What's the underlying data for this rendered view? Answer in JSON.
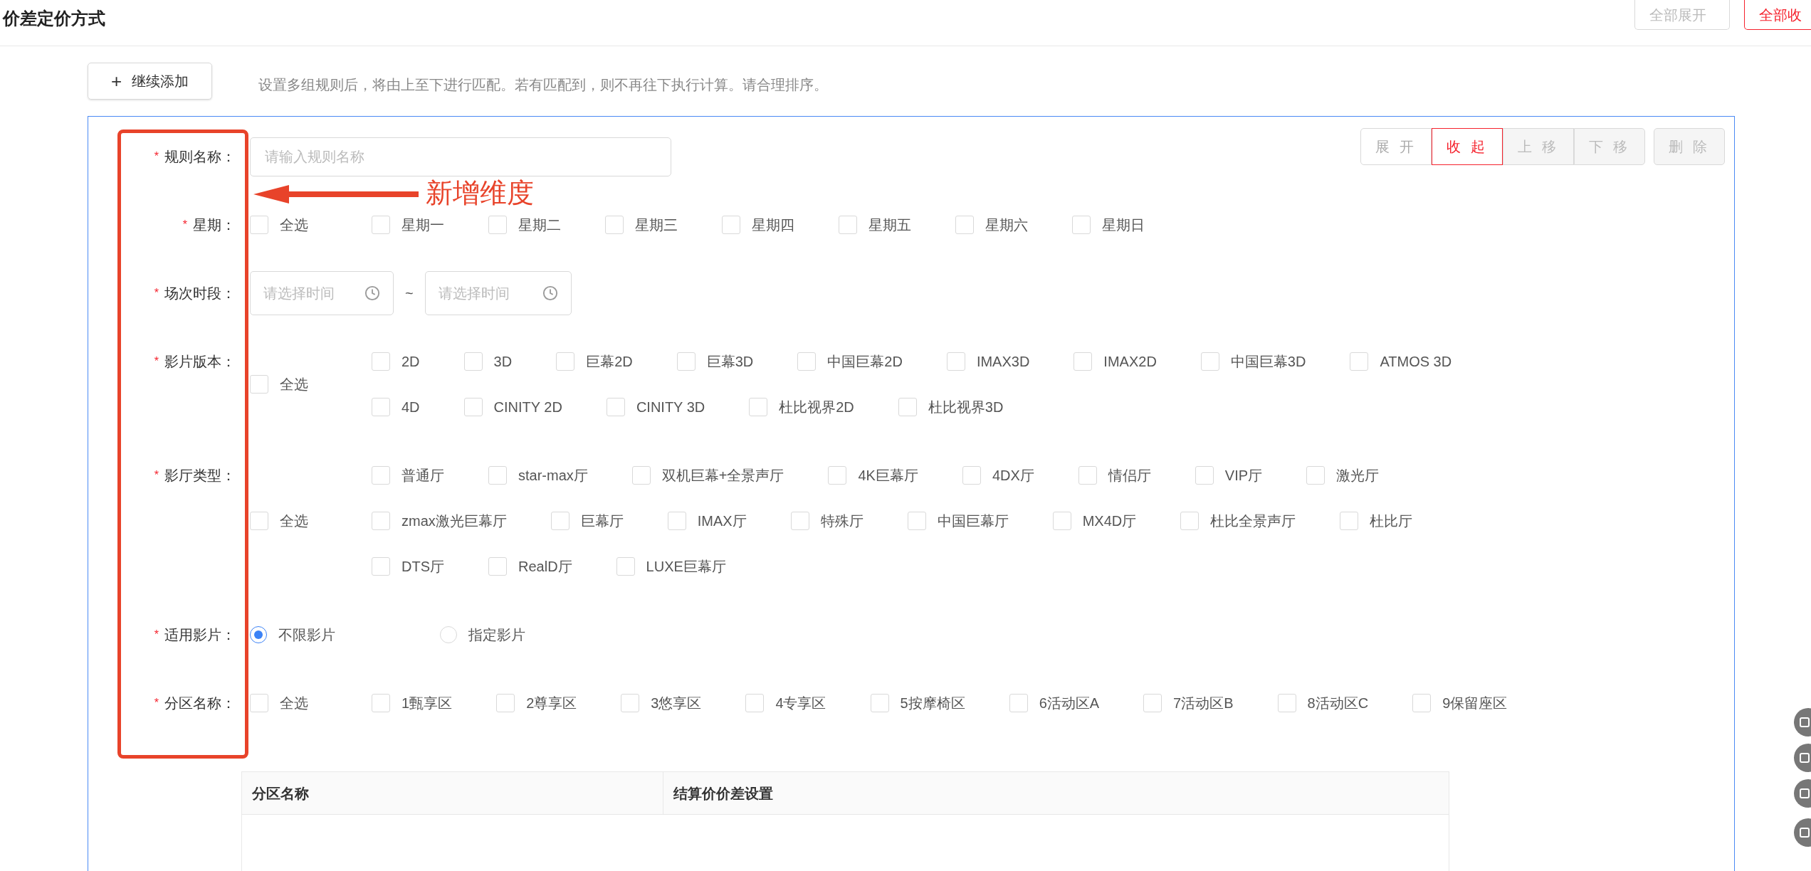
{
  "header": {
    "title": "价差定价方式",
    "buttons": [
      {
        "label": "全部展开",
        "kind": "default"
      },
      {
        "label": "全部收",
        "kind": "danger"
      }
    ]
  },
  "add_button": {
    "label": "继续添加",
    "icon": "+"
  },
  "hint": "设置多组规则后，将由上至下进行匹配。若有匹配到，则不再往下执行计算。请合理排序。",
  "rule": {
    "actions": [
      {
        "label": "展 开",
        "selected": false,
        "disabled": false
      },
      {
        "label": "收 起",
        "selected": true,
        "disabled": false
      },
      {
        "label": "上 移",
        "selected": false,
        "disabled": true
      },
      {
        "label": "下 移",
        "selected": false,
        "disabled": true
      },
      {
        "label": "删 除",
        "selected": false,
        "disabled": true
      }
    ],
    "fields": [
      {
        "kind": "input",
        "label": "规则名称：",
        "required_mark": "*",
        "placeholder": "请输入规则名称"
      },
      {
        "kind": "checkboxes",
        "label": "星期：",
        "required_mark": "*",
        "all": {
          "label": "全选",
          "checked": false
        },
        "option_rows": [
          [
            {
              "label": "星期一",
              "checked": false
            },
            {
              "label": "星期二",
              "checked": false
            },
            {
              "label": "星期三",
              "checked": false
            },
            {
              "label": "星期四",
              "checked": false
            },
            {
              "label": "星期五",
              "checked": false
            },
            {
              "label": "星期六",
              "checked": false
            },
            {
              "label": "星期日",
              "checked": false
            }
          ]
        ]
      },
      {
        "kind": "time_range",
        "label": "场次时段：",
        "required_mark": "*",
        "start_placeholder": "请选择时间",
        "separator": "~",
        "end_placeholder": "请选择时间"
      },
      {
        "kind": "checkboxes",
        "label": "影片版本：",
        "required_mark": "*",
        "all": {
          "label": "全选",
          "checked": false
        },
        "option_rows": [
          [
            {
              "label": "2D",
              "checked": false
            },
            {
              "label": "3D",
              "checked": false
            },
            {
              "label": "巨幕2D",
              "checked": false
            },
            {
              "label": "巨幕3D",
              "checked": false
            },
            {
              "label": "中国巨幕2D",
              "checked": false
            },
            {
              "label": "IMAX3D",
              "checked": false
            },
            {
              "label": "IMAX2D",
              "checked": false
            },
            {
              "label": "中国巨幕3D",
              "checked": false
            },
            {
              "label": "ATMOS 3D",
              "checked": false
            }
          ],
          [
            {
              "label": "4D",
              "checked": false
            },
            {
              "label": "CINITY 2D",
              "checked": false
            },
            {
              "label": "CINITY 3D",
              "checked": false
            },
            {
              "label": "杜比视界2D",
              "checked": false
            },
            {
              "label": "杜比视界3D",
              "checked": false
            }
          ]
        ]
      },
      {
        "kind": "checkboxes",
        "label": "影厅类型：",
        "required_mark": "*",
        "all": {
          "label": "全选",
          "checked": false
        },
        "option_rows": [
          [
            {
              "label": "普通厅",
              "checked": false
            },
            {
              "label": "star-max厅",
              "checked": false
            },
            {
              "label": "双机巨幕+全景声厅",
              "checked": false
            },
            {
              "label": "4K巨幕厅",
              "checked": false
            },
            {
              "label": "4DX厅",
              "checked": false
            },
            {
              "label": "情侣厅",
              "checked": false
            },
            {
              "label": "VIP厅",
              "checked": false
            },
            {
              "label": "激光厅",
              "checked": false
            }
          ],
          [
            {
              "label": "zmax激光巨幕厅",
              "checked": false
            },
            {
              "label": "巨幕厅",
              "checked": false
            },
            {
              "label": "IMAX厅",
              "checked": false
            },
            {
              "label": "特殊厅",
              "checked": false
            },
            {
              "label": "中国巨幕厅",
              "checked": false
            },
            {
              "label": "MX4D厅",
              "checked": false
            },
            {
              "label": "杜比全景声厅",
              "checked": false
            },
            {
              "label": "杜比厅",
              "checked": false
            }
          ],
          [
            {
              "label": "DTS厅",
              "checked": false
            },
            {
              "label": "RealD厅",
              "checked": false
            },
            {
              "label": "LUXE巨幕厅",
              "checked": false
            }
          ]
        ]
      },
      {
        "kind": "radios",
        "label": "适用影片：",
        "required_mark": "*",
        "options": [
          {
            "label": "不限影片",
            "selected": true
          },
          {
            "label": "指定影片",
            "selected": false
          }
        ]
      },
      {
        "kind": "checkboxes",
        "label": "分区名称：",
        "required_mark": "*",
        "all": {
          "label": "全选",
          "checked": false
        },
        "option_rows": [
          [
            {
              "label": "1甄享区",
              "checked": false
            },
            {
              "label": "2尊享区",
              "checked": false
            },
            {
              "label": "3悠享区",
              "checked": false
            },
            {
              "label": "4专享区",
              "checked": false
            },
            {
              "label": "5按摩椅区",
              "checked": false
            },
            {
              "label": "6活动区A",
              "checked": false
            },
            {
              "label": "7活动区B",
              "checked": false
            },
            {
              "label": "8活动区C",
              "checked": false
            },
            {
              "label": "9保留座区",
              "checked": false
            }
          ]
        ]
      }
    ],
    "table": {
      "columns": [
        "分区名称",
        "结算价价差设置"
      ]
    }
  },
  "annotation": {
    "text": "新增维度"
  }
}
